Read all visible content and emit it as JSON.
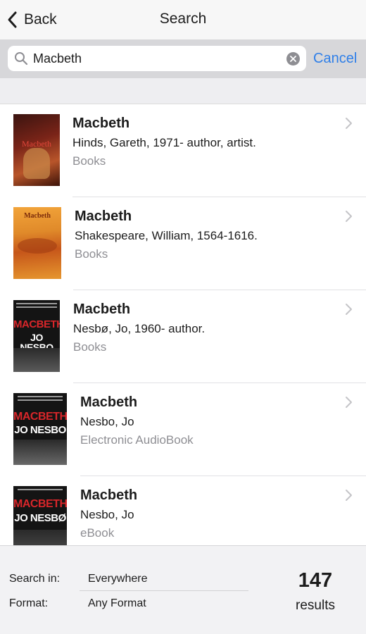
{
  "nav": {
    "back_label": "Back",
    "title": "Search"
  },
  "search": {
    "value": "Macbeth",
    "cancel_label": "Cancel"
  },
  "results": [
    {
      "title": "Macbeth",
      "author": "Hinds, Gareth, 1971- author, artist.",
      "format": "Books",
      "cover_title": "Macbeth",
      "cover_author": ""
    },
    {
      "title": "Macbeth",
      "author": "Shakespeare, William, 1564-1616.",
      "format": "Books",
      "cover_title": "Macbeth",
      "cover_author": ""
    },
    {
      "title": "Macbeth",
      "author": "Nesbø, Jo, 1960- author.",
      "format": "Books",
      "cover_title": "MACBETH",
      "cover_author": "JO NESBO"
    },
    {
      "title": "Macbeth",
      "author": "Nesbo, Jo",
      "format": "Electronic AudioBook",
      "cover_title": "MACBETH",
      "cover_author": "JO NESBO"
    },
    {
      "title": "Macbeth",
      "author": "Nesbo, Jo",
      "format": "eBook",
      "cover_title": "MACBETH",
      "cover_author": "JO NESBØ"
    }
  ],
  "footer": {
    "search_in_label": "Search in:",
    "search_in_value": "Everywhere",
    "format_label": "Format:",
    "format_value": "Any Format",
    "count": "147",
    "count_label": "results"
  },
  "colors": {
    "accent": "#2f7fe8",
    "secondary_text": "#8e8e93",
    "cover_red": "#d8262a"
  }
}
